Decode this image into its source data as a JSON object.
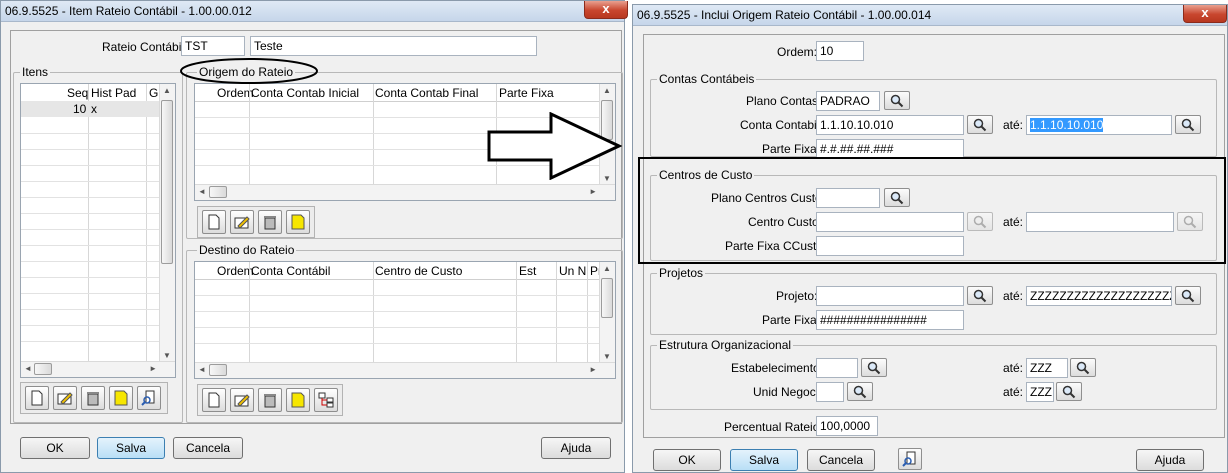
{
  "left_window": {
    "title": "06.9.5525 - Item Rateio Contábil - 1.00.00.012",
    "close": "x",
    "rateio_label": "Rateio Contábil:",
    "rateio_code": "TST",
    "rateio_desc": "Teste",
    "itens": {
      "legend": "Itens",
      "columns": [
        "Seq",
        "Hist Pad",
        "Gi"
      ],
      "rows": [
        {
          "seq": "10",
          "hist": "x"
        }
      ]
    },
    "origem": {
      "legend": "Origem do Rateio",
      "columns": [
        "Ordem",
        "Conta Contab Inicial",
        "Conta Contab Final",
        "Parte Fixa"
      ]
    },
    "destino": {
      "legend": "Destino do Rateio",
      "columns": [
        "Ordem",
        "Conta Contábil",
        "Centro de Custo",
        "Est",
        "Un N",
        "Pr"
      ]
    },
    "buttons": {
      "ok": "OK",
      "salva": "Salva",
      "cancela": "Cancela",
      "ajuda": "Ajuda"
    }
  },
  "right_window": {
    "title": "06.9.5525 - Inclui Origem Rateio Contábil - 1.00.00.014",
    "close": "x",
    "ordem_label": "Ordem:",
    "ordem": "10",
    "contas": {
      "legend": "Contas Contábeis",
      "plano_label": "Plano Contas:",
      "plano": "PADRAO",
      "conta_label": "Conta Contabil:",
      "conta_ini": "1.1.10.10.010",
      "ate": "até:",
      "conta_fim": "1.1.10.10.010",
      "parte_label": "Parte Fixa:",
      "parte": "#.#.##.##.###"
    },
    "centros": {
      "legend": "Centros de Custo",
      "plano_label": "Plano Centros Custo:",
      "plano": "",
      "centro_label": "Centro Custo:",
      "centro_ini": "",
      "ate": "até:",
      "centro_fim": "",
      "parte_label": "Parte Fixa CCusto:",
      "parte": ""
    },
    "projetos": {
      "legend": "Projetos",
      "projeto_label": "Projeto:",
      "projeto_ini": "",
      "ate": "até:",
      "projeto_fim": "ZZZZZZZZZZZZZZZZZZZZ",
      "parte_label": "Parte Fixa:",
      "parte": "################"
    },
    "estrutura": {
      "legend": "Estrutura Organizacional",
      "estab_label": "Estabelecimento:",
      "estab_ini": "",
      "ate": "até:",
      "estab_fim": "ZZZ",
      "unid_label": "Unid Negoc:",
      "unid_ini": "",
      "unid_fim": "ZZZ"
    },
    "percentual_label": "Percentual Rateio:",
    "percentual": "100,0000",
    "buttons": {
      "ok": "OK",
      "salva": "Salva",
      "cancela": "Cancela",
      "ajuda": "Ajuda"
    }
  }
}
